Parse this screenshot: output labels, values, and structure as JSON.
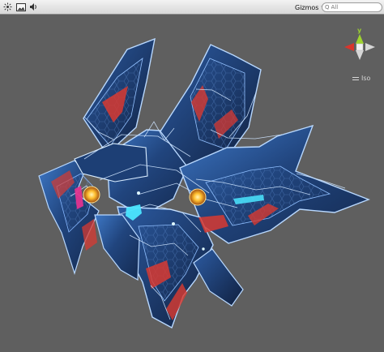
{
  "toolbar": {
    "gizmos_label": "Gizmos",
    "gizmos_arrow": "▾",
    "search_icon": "Q",
    "search_placeholder": "All",
    "buttons": [
      {
        "icon": "sun-icon"
      },
      {
        "icon": "image-icon"
      },
      {
        "icon": "audio-icon"
      }
    ]
  },
  "scene": {
    "model": "spaceship-mesh",
    "axis_label": "y",
    "projection_label": "Iso",
    "colors": {
      "background": "#5f5f5f",
      "hull_blue": "#244a86",
      "wire": "#b8d8ff",
      "red": "#d83a31",
      "cyan": "#4be6ff",
      "magenta": "#e0338f",
      "orange": "#f2a31c"
    }
  }
}
